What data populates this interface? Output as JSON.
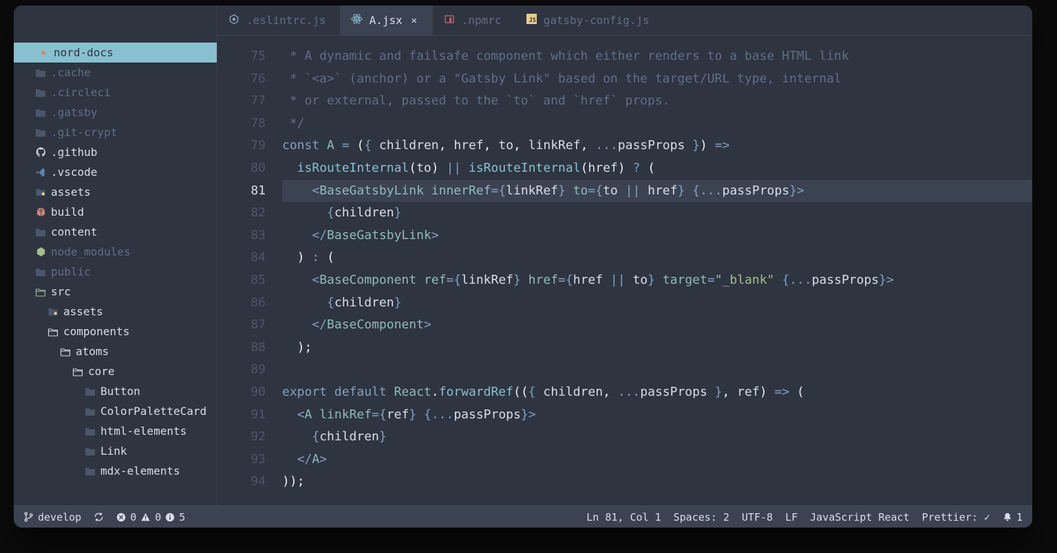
{
  "sidebar": {
    "root": "nord-docs",
    "items": [
      {
        "label": ".cache",
        "indent": 1,
        "icon": "folder",
        "dim": true
      },
      {
        "label": ".circleci",
        "indent": 1,
        "icon": "folder",
        "dim": true
      },
      {
        "label": ".gatsby",
        "indent": 1,
        "icon": "folder",
        "dim": true
      },
      {
        "label": ".git-crypt",
        "indent": 1,
        "icon": "folder",
        "dim": true
      },
      {
        "label": ".github",
        "indent": 1,
        "icon": "github",
        "bright": true
      },
      {
        "label": ".vscode",
        "indent": 1,
        "icon": "vscode",
        "bright": true
      },
      {
        "label": "assets",
        "indent": 1,
        "icon": "assets",
        "bright": true
      },
      {
        "label": "build",
        "indent": 1,
        "icon": "build",
        "bright": true
      },
      {
        "label": "content",
        "indent": 1,
        "icon": "folder",
        "bright": true
      },
      {
        "label": "node_modules",
        "indent": 1,
        "icon": "node",
        "dim": true
      },
      {
        "label": "public",
        "indent": 1,
        "icon": "folder",
        "dim": true
      },
      {
        "label": "src",
        "indent": 1,
        "icon": "folder-open-src",
        "bright": true
      },
      {
        "label": "assets",
        "indent": 2,
        "icon": "assets",
        "bright": true
      },
      {
        "label": "components",
        "indent": 2,
        "icon": "folder-open",
        "bright": true
      },
      {
        "label": "atoms",
        "indent": 3,
        "icon": "folder-open",
        "bright": true
      },
      {
        "label": "core",
        "indent": 4,
        "icon": "folder-open",
        "bright": true
      },
      {
        "label": "Button",
        "indent": 5,
        "icon": "folder",
        "bright": true
      },
      {
        "label": "ColorPaletteCard",
        "indent": 5,
        "icon": "folder",
        "bright": true
      },
      {
        "label": "html-elements",
        "indent": 5,
        "icon": "folder",
        "bright": true
      },
      {
        "label": "Link",
        "indent": 5,
        "icon": "folder",
        "bright": true
      },
      {
        "label": "mdx-elements",
        "indent": 5,
        "icon": "folder",
        "bright": true
      }
    ]
  },
  "tabs": [
    {
      "label": ".eslintrc.js",
      "icon": "eslint",
      "active": false
    },
    {
      "label": "A.jsx",
      "icon": "react",
      "active": true,
      "closeable": true
    },
    {
      "label": ".npmrc",
      "icon": "npm",
      "active": false
    },
    {
      "label": "gatsby-config.js",
      "icon": "js",
      "active": false
    }
  ],
  "editor": {
    "first_line": 75,
    "current_line": 81,
    "lines": [
      {
        "n": 75,
        "tokens": [
          [
            "c-dim",
            " * A dynamic and failsafe component which either renders to a base HTML link"
          ]
        ]
      },
      {
        "n": 76,
        "tokens": [
          [
            "c-dim",
            " * `<a>` (anchor) or a \"Gatsby Link\" based on the target/URL type, internal"
          ]
        ]
      },
      {
        "n": 77,
        "tokens": [
          [
            "c-dim",
            " * or external, passed to the `to` and `href` props."
          ]
        ]
      },
      {
        "n": 78,
        "tokens": [
          [
            "c-dim",
            " */"
          ]
        ]
      },
      {
        "n": 79,
        "tokens": [
          [
            "c-kw",
            "const"
          ],
          [
            "c-var",
            " "
          ],
          [
            "c-def",
            "A"
          ],
          [
            "c-var",
            " "
          ],
          [
            "c-op",
            "="
          ],
          [
            "c-var",
            " "
          ],
          [
            "c-pun",
            "("
          ],
          [
            "c-br",
            "{"
          ],
          [
            "c-var",
            " children"
          ],
          [
            "c-pun",
            ","
          ],
          [
            "c-var",
            " href"
          ],
          [
            "c-pun",
            ","
          ],
          [
            "c-var",
            " to"
          ],
          [
            "c-pun",
            ","
          ],
          [
            "c-var",
            " linkRef"
          ],
          [
            "c-pun",
            ","
          ],
          [
            "c-var",
            " "
          ],
          [
            "c-op",
            "..."
          ],
          [
            "c-var",
            "passProps "
          ],
          [
            "c-br",
            "}"
          ],
          [
            "c-pun",
            ")"
          ],
          [
            "c-var",
            " "
          ],
          [
            "c-op",
            "=>"
          ]
        ]
      },
      {
        "n": 80,
        "tokens": [
          [
            "c-var",
            "  "
          ],
          [
            "c-fn",
            "isRouteInternal"
          ],
          [
            "c-pun",
            "("
          ],
          [
            "c-var",
            "to"
          ],
          [
            "c-pun",
            ")"
          ],
          [
            "c-var",
            " "
          ],
          [
            "c-op",
            "||"
          ],
          [
            "c-var",
            " "
          ],
          [
            "c-fn",
            "isRouteInternal"
          ],
          [
            "c-pun",
            "("
          ],
          [
            "c-var",
            "href"
          ],
          [
            "c-pun",
            ")"
          ],
          [
            "c-var",
            " "
          ],
          [
            "c-op",
            "?"
          ],
          [
            "c-var",
            " "
          ],
          [
            "c-pun",
            "("
          ]
        ]
      },
      {
        "n": 81,
        "tokens": [
          [
            "c-var",
            "    "
          ],
          [
            "c-tag",
            "<"
          ],
          [
            "c-def",
            "BaseGatsbyLink"
          ],
          [
            "c-var",
            " "
          ],
          [
            "c-attr",
            "innerRef"
          ],
          [
            "c-op",
            "="
          ],
          [
            "c-br",
            "{"
          ],
          [
            "c-var",
            "linkRef"
          ],
          [
            "c-br",
            "}"
          ],
          [
            "c-var",
            " "
          ],
          [
            "c-attr",
            "to"
          ],
          [
            "c-op",
            "="
          ],
          [
            "c-br",
            "{"
          ],
          [
            "c-var",
            "to "
          ],
          [
            "c-op",
            "||"
          ],
          [
            "c-var",
            " href"
          ],
          [
            "c-br",
            "}"
          ],
          [
            "c-var",
            " "
          ],
          [
            "c-br",
            "{"
          ],
          [
            "c-op",
            "..."
          ],
          [
            "c-var",
            "passProps"
          ],
          [
            "c-br",
            "}"
          ],
          [
            "c-tag",
            ">"
          ]
        ]
      },
      {
        "n": 82,
        "tokens": [
          [
            "c-var",
            "      "
          ],
          [
            "c-br",
            "{"
          ],
          [
            "c-var",
            "children"
          ],
          [
            "c-br",
            "}"
          ]
        ]
      },
      {
        "n": 83,
        "tokens": [
          [
            "c-var",
            "    "
          ],
          [
            "c-tag",
            "</"
          ],
          [
            "c-def",
            "BaseGatsbyLink"
          ],
          [
            "c-tag",
            ">"
          ]
        ]
      },
      {
        "n": 84,
        "tokens": [
          [
            "c-var",
            "  "
          ],
          [
            "c-pun",
            ")"
          ],
          [
            "c-var",
            " "
          ],
          [
            "c-op",
            ":"
          ],
          [
            "c-var",
            " "
          ],
          [
            "c-pun",
            "("
          ]
        ]
      },
      {
        "n": 85,
        "tokens": [
          [
            "c-var",
            "    "
          ],
          [
            "c-tag",
            "<"
          ],
          [
            "c-def",
            "BaseComponent"
          ],
          [
            "c-var",
            " "
          ],
          [
            "c-attr",
            "ref"
          ],
          [
            "c-op",
            "="
          ],
          [
            "c-br",
            "{"
          ],
          [
            "c-var",
            "linkRef"
          ],
          [
            "c-br",
            "}"
          ],
          [
            "c-var",
            " "
          ],
          [
            "c-attr",
            "href"
          ],
          [
            "c-op",
            "="
          ],
          [
            "c-br",
            "{"
          ],
          [
            "c-var",
            "href "
          ],
          [
            "c-op",
            "||"
          ],
          [
            "c-var",
            " to"
          ],
          [
            "c-br",
            "}"
          ],
          [
            "c-var",
            " "
          ],
          [
            "c-attr",
            "target"
          ],
          [
            "c-op",
            "="
          ],
          [
            "c-str",
            "\"_blank\""
          ],
          [
            "c-var",
            " "
          ],
          [
            "c-br",
            "{"
          ],
          [
            "c-op",
            "..."
          ],
          [
            "c-var",
            "passProps"
          ],
          [
            "c-br",
            "}"
          ],
          [
            "c-tag",
            ">"
          ]
        ]
      },
      {
        "n": 86,
        "tokens": [
          [
            "c-var",
            "      "
          ],
          [
            "c-br",
            "{"
          ],
          [
            "c-var",
            "children"
          ],
          [
            "c-br",
            "}"
          ]
        ]
      },
      {
        "n": 87,
        "tokens": [
          [
            "c-var",
            "    "
          ],
          [
            "c-tag",
            "</"
          ],
          [
            "c-def",
            "BaseComponent"
          ],
          [
            "c-tag",
            ">"
          ]
        ]
      },
      {
        "n": 88,
        "tokens": [
          [
            "c-var",
            "  "
          ],
          [
            "c-pun",
            ")"
          ],
          [
            "c-pun",
            ";"
          ]
        ]
      },
      {
        "n": 89,
        "tokens": [
          [
            "c-var",
            ""
          ]
        ]
      },
      {
        "n": 90,
        "tokens": [
          [
            "c-kw",
            "export"
          ],
          [
            "c-var",
            " "
          ],
          [
            "c-kw",
            "default"
          ],
          [
            "c-var",
            " "
          ],
          [
            "c-def",
            "React"
          ],
          [
            "c-pun",
            "."
          ],
          [
            "c-fn",
            "forwardRef"
          ],
          [
            "c-pun",
            "(("
          ],
          [
            "c-br",
            "{"
          ],
          [
            "c-var",
            " children"
          ],
          [
            "c-pun",
            ","
          ],
          [
            "c-var",
            " "
          ],
          [
            "c-op",
            "..."
          ],
          [
            "c-var",
            "passProps "
          ],
          [
            "c-br",
            "}"
          ],
          [
            "c-pun",
            ","
          ],
          [
            "c-var",
            " ref"
          ],
          [
            "c-pun",
            ")"
          ],
          [
            "c-var",
            " "
          ],
          [
            "c-op",
            "=>"
          ],
          [
            "c-var",
            " "
          ],
          [
            "c-pun",
            "("
          ]
        ]
      },
      {
        "n": 91,
        "tokens": [
          [
            "c-var",
            "  "
          ],
          [
            "c-tag",
            "<"
          ],
          [
            "c-def",
            "A"
          ],
          [
            "c-var",
            " "
          ],
          [
            "c-attr",
            "linkRef"
          ],
          [
            "c-op",
            "="
          ],
          [
            "c-br",
            "{"
          ],
          [
            "c-var",
            "ref"
          ],
          [
            "c-br",
            "}"
          ],
          [
            "c-var",
            " "
          ],
          [
            "c-br",
            "{"
          ],
          [
            "c-op",
            "..."
          ],
          [
            "c-var",
            "passProps"
          ],
          [
            "c-br",
            "}"
          ],
          [
            "c-tag",
            ">"
          ]
        ]
      },
      {
        "n": 92,
        "tokens": [
          [
            "c-var",
            "    "
          ],
          [
            "c-br",
            "{"
          ],
          [
            "c-var",
            "children"
          ],
          [
            "c-br",
            "}"
          ]
        ]
      },
      {
        "n": 93,
        "tokens": [
          [
            "c-var",
            "  "
          ],
          [
            "c-tag",
            "</"
          ],
          [
            "c-def",
            "A"
          ],
          [
            "c-tag",
            ">"
          ]
        ]
      },
      {
        "n": 94,
        "tokens": [
          [
            "c-pun",
            "))"
          ],
          [
            "c-pun",
            ";"
          ]
        ]
      }
    ]
  },
  "statusbar": {
    "branch": "develop",
    "errors": "0",
    "warnings": "0",
    "infos": "5",
    "pos": "Ln 81, Col 1",
    "spaces": "Spaces: 2",
    "encoding": "UTF-8",
    "eol": "LF",
    "lang": "JavaScript React",
    "prettier": "Prettier: ✓",
    "bell": "1"
  }
}
